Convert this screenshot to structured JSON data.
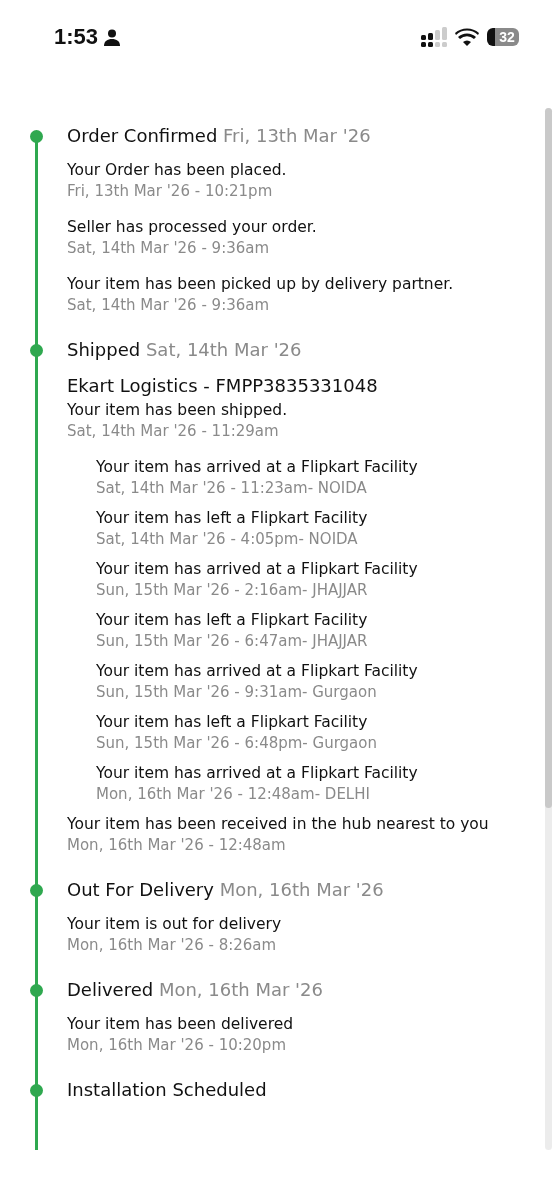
{
  "status_bar": {
    "time": "1:53",
    "battery": "32"
  },
  "stages": [
    {
      "title": "Order Confirmed",
      "date": "Fri, 13th Mar '26",
      "events": [
        {
          "kind": "event",
          "text": "Your Order has been placed.",
          "time": "Fri, 13th Mar '26 - 10:21pm"
        },
        {
          "kind": "event",
          "text": "Seller has processed your order.",
          "time": "Sat, 14th Mar '26 - 9:36am"
        },
        {
          "kind": "event",
          "text": "Your item has been picked up by delivery partner.",
          "time": "Sat, 14th Mar '26 - 9:36am"
        }
      ]
    },
    {
      "title": "Shipped",
      "date": "Sat, 14th Mar '26",
      "events": [
        {
          "kind": "carrier",
          "text": "Ekart Logistics - FMPP3835331048"
        },
        {
          "kind": "event",
          "text": "Your item has been shipped.",
          "time": "Sat, 14th Mar '26 - 11:29am"
        },
        {
          "kind": "sub",
          "text": "Your item has arrived at a Flipkart Facility",
          "time": "Sat, 14th Mar '26 - 11:23am- NOIDA"
        },
        {
          "kind": "sub",
          "text": "Your item has left a Flipkart Facility",
          "time": "Sat, 14th Mar '26 - 4:05pm- NOIDA"
        },
        {
          "kind": "sub",
          "text": "Your item has arrived at a Flipkart Facility",
          "time": "Sun, 15th Mar '26 - 2:16am- JHAJJAR"
        },
        {
          "kind": "sub",
          "text": "Your item has left a Flipkart Facility",
          "time": "Sun, 15th Mar '26 - 6:47am- JHAJJAR"
        },
        {
          "kind": "sub",
          "text": "Your item has arrived at a Flipkart Facility",
          "time": "Sun, 15th Mar '26 - 9:31am- Gurgaon"
        },
        {
          "kind": "sub",
          "text": "Your item has left a Flipkart Facility",
          "time": "Sun, 15th Mar '26 - 6:48pm- Gurgaon"
        },
        {
          "kind": "sub",
          "text": "Your item has arrived at a Flipkart Facility",
          "time": "Mon, 16th Mar '26 - 12:48am- DELHI"
        },
        {
          "kind": "event",
          "text": "Your item has been received in the hub nearest to you",
          "time": "Mon, 16th Mar '26 - 12:48am"
        }
      ]
    },
    {
      "title": "Out For Delivery",
      "date": "Mon, 16th Mar '26",
      "events": [
        {
          "kind": "event",
          "text": "Your item is out for delivery",
          "time": "Mon, 16th Mar '26 - 8:26am"
        }
      ]
    },
    {
      "title": "Delivered",
      "date": "Mon, 16th Mar '26",
      "events": [
        {
          "kind": "event",
          "text": "Your item has been delivered",
          "time": "Mon, 16th Mar '26 - 10:20pm"
        }
      ]
    },
    {
      "title": "Installation Scheduled"
    }
  ]
}
